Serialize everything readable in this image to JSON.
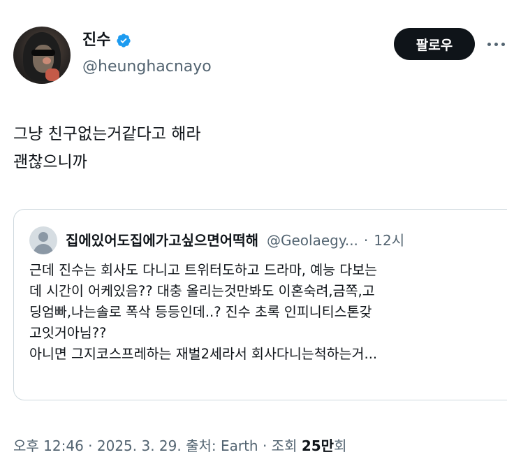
{
  "author": {
    "name": "진수",
    "handle": "@heunghacnayo",
    "verified_color": "#1d9bf0"
  },
  "follow_label": "팔로우",
  "tweet": {
    "lines": [
      "그냥 친구없는거같다고 해라",
      "괜찮으니까"
    ]
  },
  "quote": {
    "name": "집에있어도집에가고싶으면어떡해",
    "handle": "@Geolaegy...",
    "sep": "·",
    "time": "12시",
    "lines": [
      "근데 진수는 회사도 다니고 트위터도하고 드라마, 예능 다보는",
      "데 시간이 어케있음??  대충 올리는것만봐도 이혼숙려,금쪽,고",
      "딩엄빠,나는솔로 폭삭 등등인데..? 진수 초록 인피니티스톤갖",
      "고잇거아님??",
      "아니면 그지코스프레하는 재벌2세라서 회사다니는척하는거..."
    ]
  },
  "meta": {
    "prefix": "오후 12:46 · 2025. 3. 29. 출처: Earth · 조회 ",
    "views": "25만",
    "suffix": "회"
  },
  "icons": {
    "avatar": "profile-photo",
    "verified": "verified-badge-icon",
    "more": "more-dots-icon",
    "quote_avatar": "default-avatar-icon"
  }
}
